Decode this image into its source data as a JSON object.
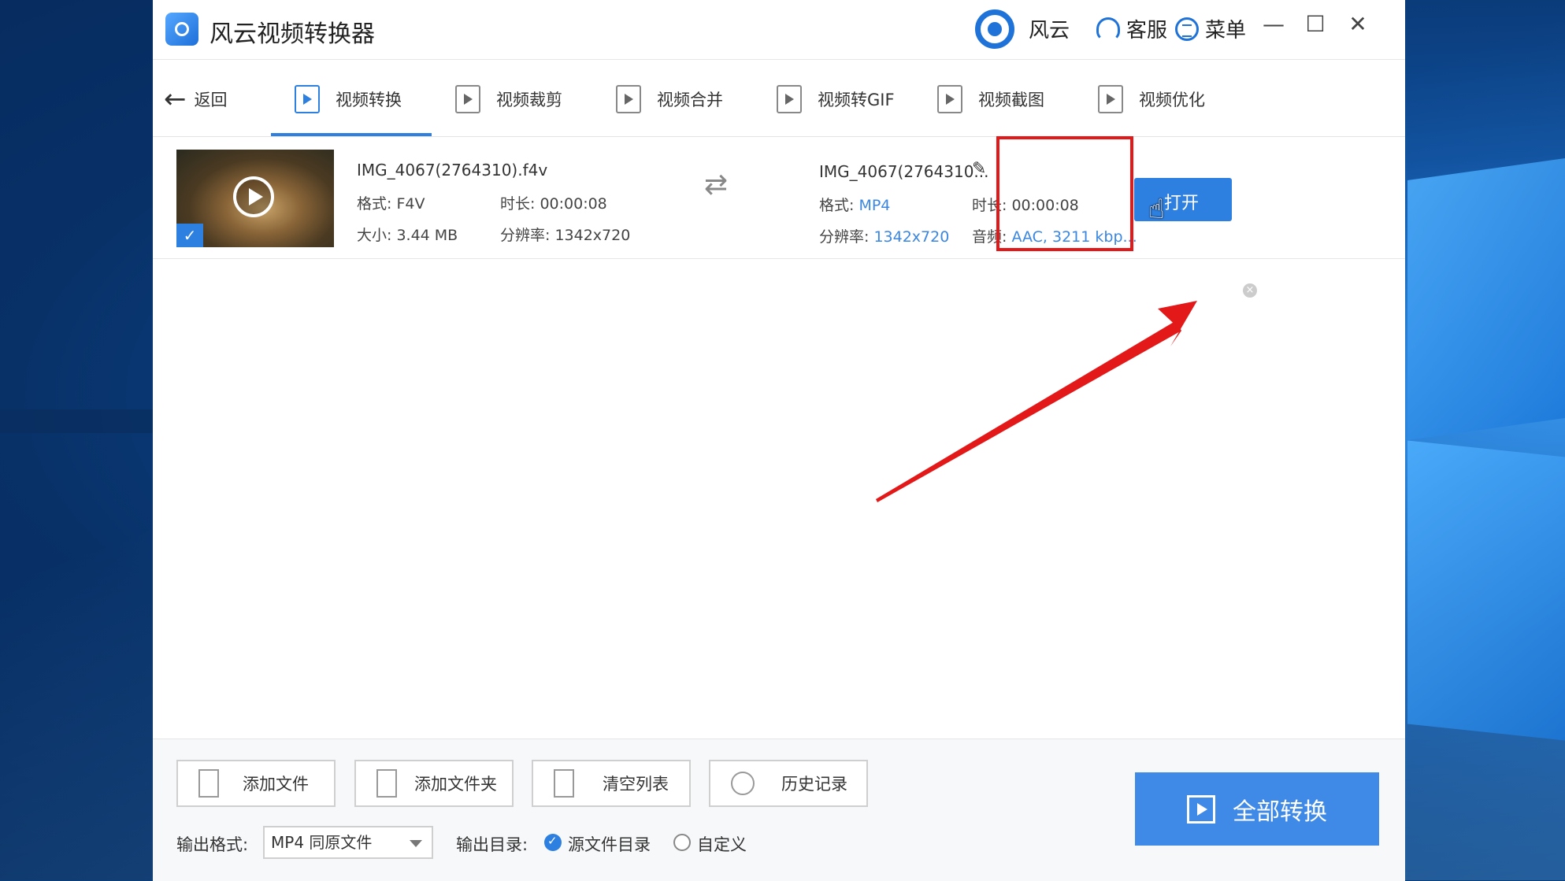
{
  "app": {
    "title": "风云视频转换器",
    "brand_label": "风云",
    "support_label": "客服",
    "menu_label": "菜单",
    "minimize": "—",
    "maximize": "☐",
    "close": "✕"
  },
  "toolbar": {
    "back_label": "返回",
    "tabs": [
      {
        "label": "视频转换",
        "icon": "video-convert-icon",
        "active": true
      },
      {
        "label": "视频裁剪",
        "icon": "video-crop-icon",
        "active": false
      },
      {
        "label": "视频合并",
        "icon": "video-merge-icon",
        "active": false
      },
      {
        "label": "视频转GIF",
        "icon": "gif-icon",
        "active": false
      },
      {
        "label": "视频截图",
        "icon": "screenshot-icon",
        "active": false
      },
      {
        "label": "视频优化",
        "icon": "optimize-icon",
        "active": false
      }
    ]
  },
  "file": {
    "source": {
      "name": "IMG_4067(2764310).f4v",
      "format": "格式: F4V",
      "duration": "时长: 00:00:08",
      "size": "大小: 3.44 MB",
      "resolution": "分辨率: 1342x720"
    },
    "output": {
      "name": "IMG_4067(2764310...",
      "format_label": "格式:",
      "format_value": "MP4",
      "duration": "时长: 00:00:08",
      "resolution_label": "分辨率:",
      "resolution_value": "1342x720",
      "audio_label": "音频:",
      "audio_value": "AAC, 3211 kbp..."
    },
    "open_button": "打开"
  },
  "bottom": {
    "add_file": "添加文件",
    "add_folder": "添加文件夹",
    "clear_list": "清空列表",
    "history": "历史记录",
    "convert_all": "全部转换",
    "output_format_label": "输出格式:",
    "output_format_value": "MP4 同原文件",
    "output_dir_label": "输出目录:",
    "dir_option_source": "源文件目录",
    "dir_option_custom": "自定义"
  },
  "colors": {
    "accent": "#2d7fe0",
    "highlight_box": "#e31919",
    "annotation_arrow": "#e31919"
  }
}
